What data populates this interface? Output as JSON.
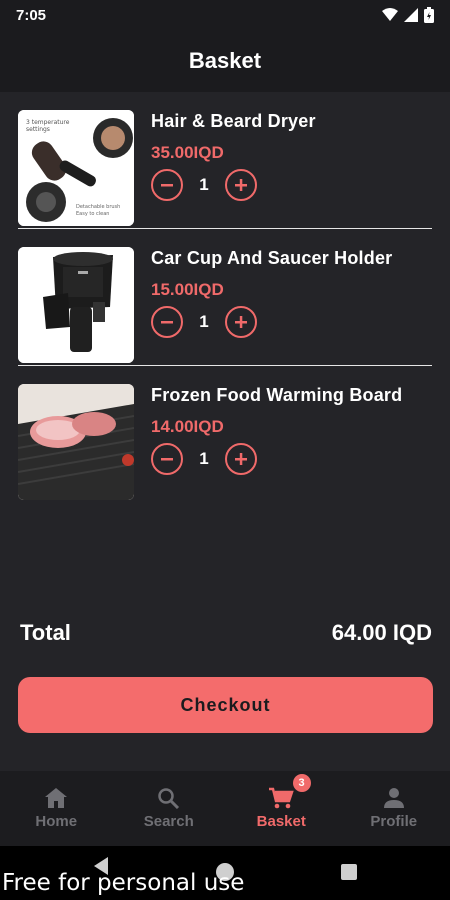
{
  "status_bar": {
    "time": "7:05"
  },
  "header": {
    "title": "Basket"
  },
  "items": [
    {
      "name": "Hair & Beard Dryer",
      "price": "35.00IQD",
      "quantity": "1",
      "image": "hair-dryer-image"
    },
    {
      "name": "Car Cup And Saucer Holder",
      "price": "15.00IQD",
      "quantity": "1",
      "image": "cup-holder-image"
    },
    {
      "name": "Frozen Food Warming Board",
      "price": "14.00IQD",
      "quantity": "1",
      "image": "defrost-board-image"
    }
  ],
  "summary": {
    "total_label": "Total",
    "total_value": "64.00 IQD"
  },
  "checkout": {
    "label": "Checkout"
  },
  "nav": {
    "items": [
      {
        "label": "Home",
        "icon": "home-icon"
      },
      {
        "label": "Search",
        "icon": "search-icon"
      },
      {
        "label": "Basket",
        "icon": "cart-icon",
        "badge": "3",
        "active": true
      },
      {
        "label": "Profile",
        "icon": "person-icon"
      }
    ]
  },
  "watermark": "Free for personal use",
  "colors": {
    "accent": "#f06a6a",
    "background": "#242428",
    "bar": "#1b1b1e"
  }
}
